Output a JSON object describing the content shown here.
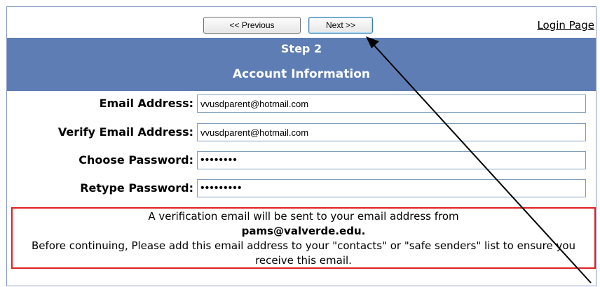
{
  "nav": {
    "previous_label": "<< Previous",
    "next_label": "Next >>",
    "login_link": "Login Page"
  },
  "header": {
    "step": "Step 2",
    "title": "Account Information",
    "background": "#5d7db4"
  },
  "form": {
    "email": {
      "label": "Email Address:",
      "value": "vvusdparent@hotmail.com"
    },
    "verify_email": {
      "label": "Verify Email Address:",
      "value": "vvusdparent@hotmail.com"
    },
    "password": {
      "label": "Choose Password:",
      "value": "••••••••"
    },
    "retype_password": {
      "label": "Retype Password:",
      "value": "•••••••••"
    }
  },
  "notice": {
    "line1": "A verification email will be sent to your email address from",
    "sender": "pams@valverde.edu",
    "line2": "Before continuing, Please add this email address to your \"contacts\" or \"safe senders\" list to ensure you receive this email.",
    "border_color": "#e02020"
  }
}
